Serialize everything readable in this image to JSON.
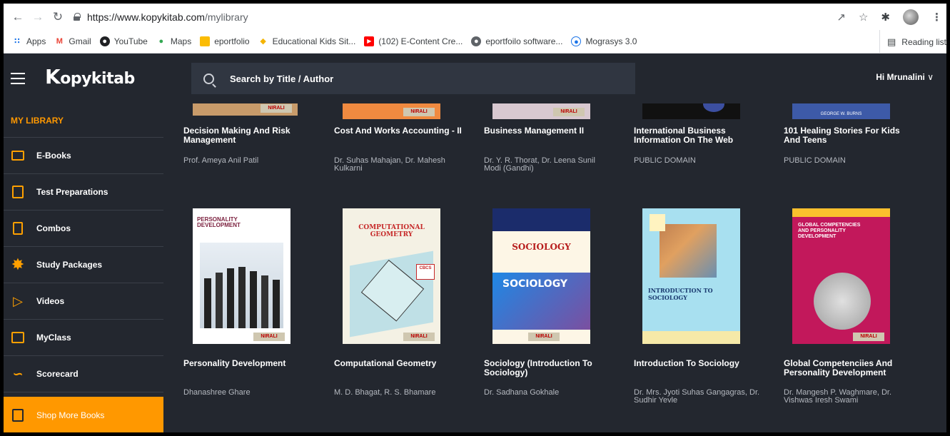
{
  "browser": {
    "url_host": "https://www.kopykitab.com",
    "url_path": "/mylibrary",
    "bookmarks": [
      {
        "label": "Apps",
        "icon": "apps-grid-icon",
        "color": "#1a73e8"
      },
      {
        "label": "Gmail",
        "icon": "gmail-icon",
        "color": "#ea4335"
      },
      {
        "label": "YouTube",
        "icon": "youtube-icon",
        "color": "#202124"
      },
      {
        "label": "Maps",
        "icon": "maps-icon",
        "color": "#34a853"
      },
      {
        "label": "eportfolio",
        "icon": "folder-icon",
        "color": "#fbbc04"
      },
      {
        "label": "Educational Kids Sit...",
        "icon": "kids-icon",
        "color": "#34a853"
      },
      {
        "label": "(102) E-Content Cre...",
        "icon": "youtube-red-icon",
        "color": "#ff0000"
      },
      {
        "label": "eportfoilo software...",
        "icon": "globe-icon",
        "color": "#5f6368"
      },
      {
        "label": "Mograsys 3.0",
        "icon": "mograsys-icon",
        "color": "#1a73e8"
      }
    ],
    "reading_list": "Reading list"
  },
  "header": {
    "logo_k": "K",
    "logo_rest": "opykitab",
    "search_placeholder": "Search by Title / Author",
    "greeting": "Hi Mrunalini"
  },
  "sidebar": {
    "section_title": "MY LIBRARY",
    "items": [
      {
        "label": "E-Books",
        "icon": "ebook-icon"
      },
      {
        "label": "Test Preparations",
        "icon": "test-icon"
      },
      {
        "label": "Combos",
        "icon": "combo-icon"
      },
      {
        "label": "Study Packages",
        "icon": "star-burst-icon"
      },
      {
        "label": "Videos",
        "icon": "play-icon"
      },
      {
        "label": "MyClass",
        "icon": "class-icon"
      },
      {
        "label": "Scorecard",
        "icon": "chart-line-icon"
      }
    ],
    "shop": "Shop More Books"
  },
  "books_top": [
    {
      "title": "Decision Making And Risk Management",
      "author": "Prof. Ameya Anil Patil"
    },
    {
      "title": "Cost And Works Accounting - II",
      "author": "Dr. Suhas Mahajan, Dr. Mahesh Kulkarni"
    },
    {
      "title": "Business Management II",
      "author": "Dr. Y. R. Thorat, Dr. Leena Sunil Modi (Gandhi)"
    },
    {
      "title": "International Business Information On The Web",
      "author": "PUBLIC DOMAIN"
    },
    {
      "title": "101 Healing Stories For Kids And Teens",
      "author": "PUBLIC DOMAIN"
    }
  ],
  "books_bottom": [
    {
      "title": "Personality Development",
      "author": "Dhanashree Ghare",
      "cover_text": "PERSONALITY DEVELOPMENT"
    },
    {
      "title": "Computational Geometry",
      "author": "M. D. Bhagat, R. S. Bhamare",
      "cover_text": "COMPUTATIONAL GEOMETRY"
    },
    {
      "title": "Sociology (Introduction To Sociology)",
      "author": "Dr. Sadhana Gokhale",
      "cover_text": "SOCIOLOGY"
    },
    {
      "title": "Introduction To Sociology",
      "author": "Dr. Mrs. Jyoti Suhas Gangagras, Dr. Sudhir Yevle",
      "cover_text": "INTRODUCTION TO SOCIOLOGY"
    },
    {
      "title": "Global Competenciies And Personality Development",
      "author": "Dr. Mangesh P. Waghmare, Dr. Vishwas Iresh Swami",
      "cover_text": "GLOBAL COMPETENCIES AND PERSONALITY DEVELOPMENT"
    }
  ],
  "publisher_badge": "NIRALI",
  "colors": {
    "accent": "#ff9800",
    "background": "#23272f",
    "search_bg": "#303641"
  }
}
